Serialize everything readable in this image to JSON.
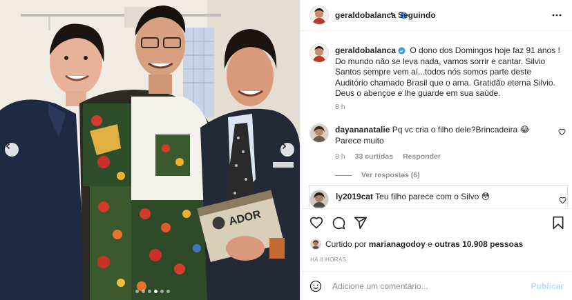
{
  "post": {
    "username": "geraldobalanca",
    "follow_separator": "•",
    "follow_status": "Seguindo",
    "caption": "O dono dos Domingos hoje faz 91 anos ! Do mundo não se leva nada, vamos sorrir e cantar. Silvio Santos sempre vem aí...todos nós somos parte deste Auditório chamado Brasil que o ama. Gratidão eterna Silvio. Deus o abençoe e lhe guarde em sua saúde.",
    "caption_time": "8 h",
    "book_text": "ADOR"
  },
  "comments": [
    {
      "username": "dayananatalie",
      "text": "Pq vc cria o filho dele?Brincadeira 😂 Parece muito",
      "time": "8 h",
      "likes": "33 curtidas",
      "reply": "Responder",
      "view_replies": "Ver respostas (6)"
    },
    {
      "username": "ly2019cat",
      "text": "Teu filho parece com o Silvo 😳"
    }
  ],
  "likes_summary": {
    "prefix": "Curtido por",
    "user": "marianagodoy",
    "connector": "e",
    "others": "outras 10.908 pessoas"
  },
  "post_age": "HÁ 8 HORAS",
  "comment_box": {
    "placeholder": "Adicione um comentário...",
    "publish": "Publicar"
  },
  "colors": {
    "verified": "#3897f0",
    "publish_disabled": "#b2dffc",
    "muted": "#8e8e8e"
  },
  "icons": [
    "chevron-left-icon",
    "chevron-right-icon",
    "more-icon",
    "verified-icon",
    "heart-icon",
    "comment-icon",
    "share-icon",
    "bookmark-icon",
    "emoji-icon"
  ]
}
